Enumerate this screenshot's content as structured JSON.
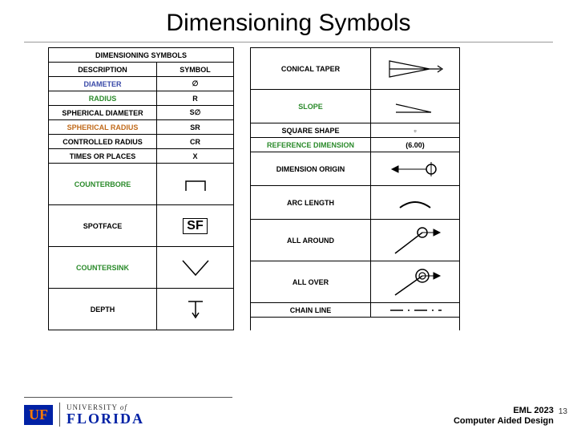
{
  "title": "Dimensioning Symbols",
  "left_header": {
    "title": "DIMENSIONING SYMBOLS",
    "col1": "DESCRIPTION",
    "col2": "SYMBOL"
  },
  "left": [
    {
      "desc": "DIAMETER",
      "sym": "∅",
      "descClass": "blue"
    },
    {
      "desc": "RADIUS",
      "sym": "R",
      "descClass": "green"
    },
    {
      "desc": "SPHERICAL DIAMETER",
      "sym": "S∅"
    },
    {
      "desc": "SPHERICAL RADIUS",
      "sym": "SR",
      "descClass": "orange"
    },
    {
      "desc": "CONTROLLED RADIUS",
      "sym": "CR"
    },
    {
      "desc": "TIMES OR PLACES",
      "sym": "X"
    },
    {
      "desc": "COUNTERBORE",
      "icon": "counterbore",
      "descClass": "green",
      "h": "tall"
    },
    {
      "desc": "SPOTFACE",
      "icon": "spotface",
      "h": "tall"
    },
    {
      "desc": "COUNTERSINK",
      "icon": "countersink",
      "descClass": "green",
      "h": "tall"
    },
    {
      "desc": "DEPTH",
      "icon": "depth",
      "h": "tall"
    }
  ],
  "right": [
    {
      "desc": "CONICAL TAPER",
      "icon": "conical",
      "h": "tall"
    },
    {
      "desc": "SLOPE",
      "icon": "slope",
      "descClass": "green",
      "h": "med"
    },
    {
      "desc": "SQUARE SHAPE",
      "sym": "▫"
    },
    {
      "desc": "REFERENCE DIMENSION",
      "sym": "(6.00)",
      "descClass": "green"
    },
    {
      "desc": "DIMENSION ORIGIN",
      "icon": "origin",
      "h": "med"
    },
    {
      "desc": "ARC LENGTH",
      "icon": "arc",
      "h": "med"
    },
    {
      "desc": "ALL AROUND",
      "icon": "allaround",
      "h": "tall"
    },
    {
      "desc": "ALL OVER",
      "icon": "allover",
      "h": "tall"
    },
    {
      "desc": "CHAIN LINE",
      "icon": "chain"
    }
  ],
  "footer": {
    "uf_mark": "UF",
    "uf_top_a": "UNIVERSITY",
    "uf_top_b": "of",
    "uf_bot": "FLORIDA",
    "course_a": "EML 2023",
    "course_b": "Computer Aided Design",
    "page": "13"
  }
}
